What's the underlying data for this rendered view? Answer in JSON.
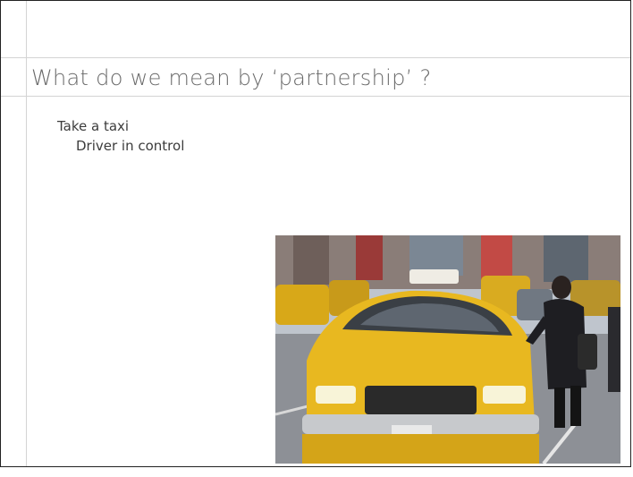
{
  "slide": {
    "title": "What do we mean by ‘partnership’ ?",
    "bullets": [
      "Take a taxi",
      "Driver in control"
    ]
  },
  "photo": {
    "subject": "yellow-taxi-street-photo",
    "colors": {
      "taxi_yellow": "#e8b820",
      "sky": "#c9cfd8",
      "road": "#8d9096",
      "coat": "#1e1e22"
    }
  }
}
